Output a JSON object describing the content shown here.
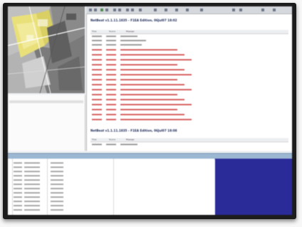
{
  "main": {
    "section1_title": "NetBeat v1.1.11.1835 - F1EA Edition, 06Jul07 18:02",
    "section2_title": "NetBeat v1.1.11.1835 - F1EA Edition, 06Jul07 18:08",
    "columns": [
      "Time",
      "Source",
      "Message"
    ]
  },
  "colors": {
    "error_text": "#cf3232",
    "accent_navy": "#2a2a98",
    "splitter": "#9bb7d2"
  }
}
